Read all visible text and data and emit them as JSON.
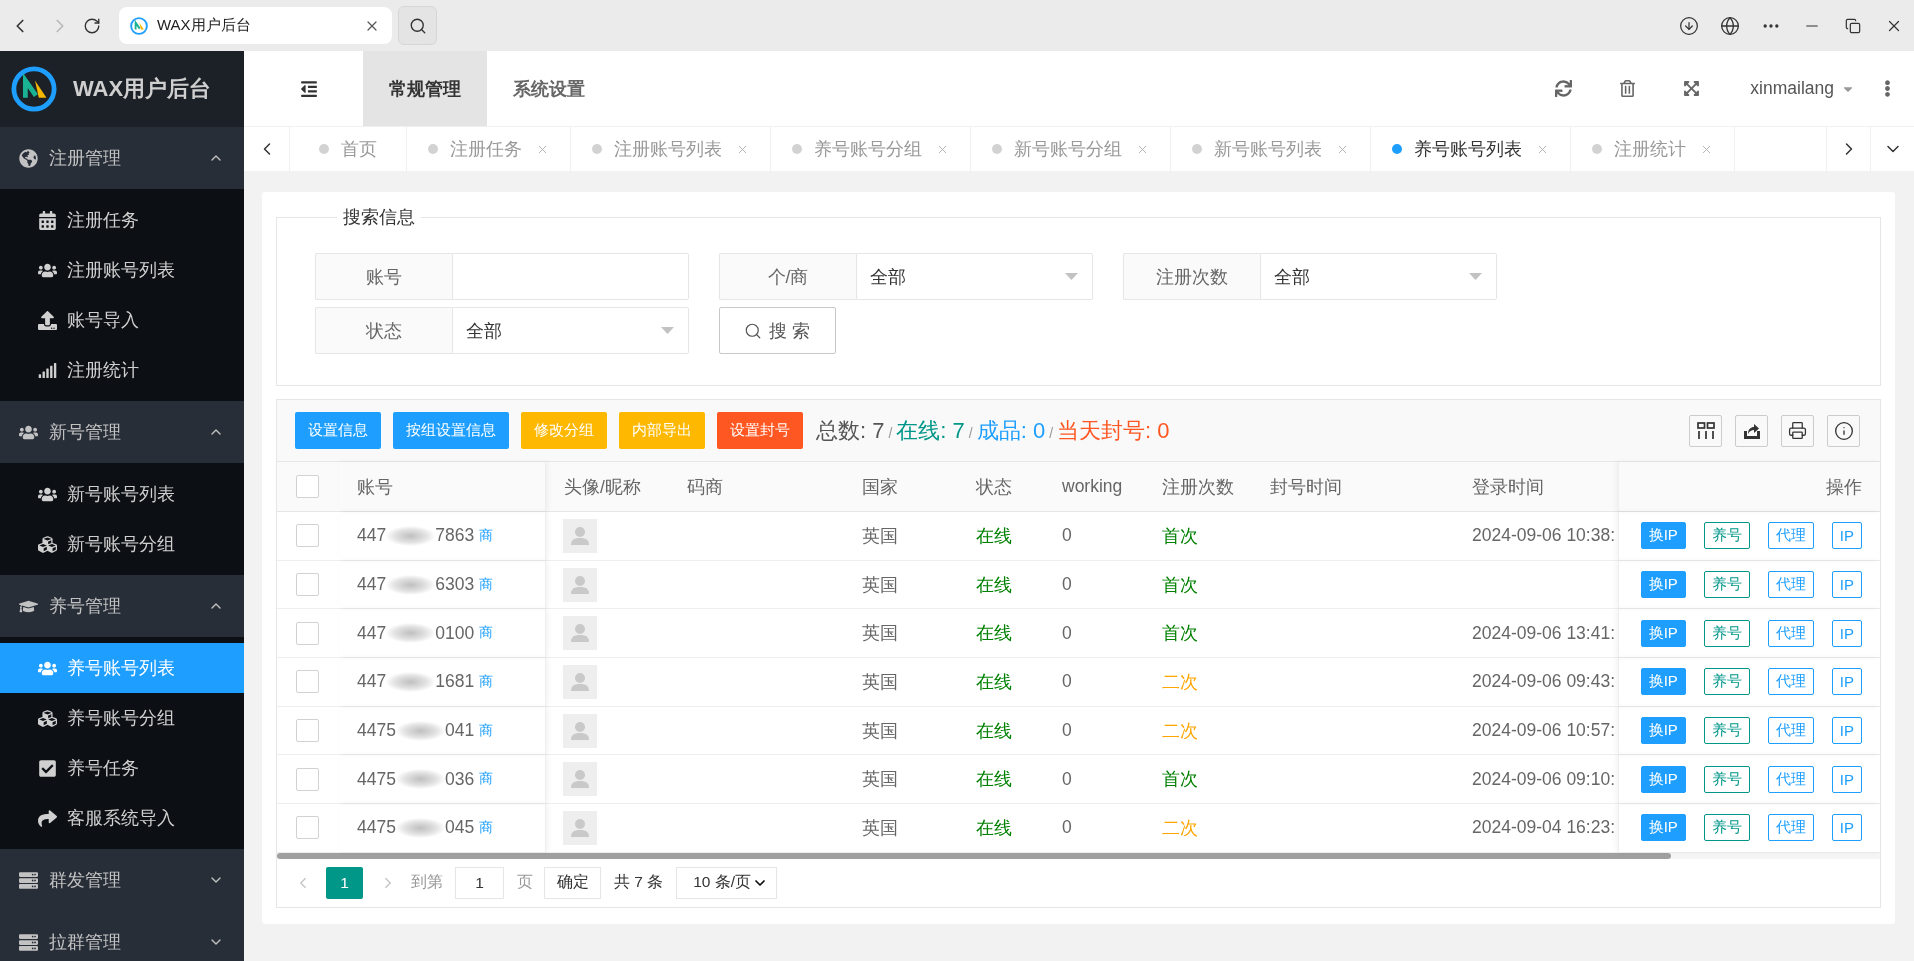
{
  "browser": {
    "tab_title": "WAX用户后台"
  },
  "sidebar": {
    "title": "WAX用户后台",
    "groups": [
      {
        "label": "注册管理",
        "expanded": true,
        "children": [
          {
            "label": "注册任务",
            "selected": false
          },
          {
            "label": "注册账号列表",
            "selected": false
          },
          {
            "label": "账号导入",
            "selected": false
          },
          {
            "label": "注册统计",
            "selected": false
          }
        ]
      },
      {
        "label": "新号管理",
        "expanded": true,
        "children": [
          {
            "label": "新号账号列表",
            "selected": false
          },
          {
            "label": "新号账号分组",
            "selected": false
          }
        ]
      },
      {
        "label": "养号管理",
        "expanded": true,
        "children": [
          {
            "label": "养号账号列表",
            "selected": true
          },
          {
            "label": "养号账号分组",
            "selected": false
          },
          {
            "label": "养号任务",
            "selected": false
          },
          {
            "label": "客服系统导入",
            "selected": false
          }
        ]
      },
      {
        "label": "群发管理",
        "expanded": false
      },
      {
        "label": "拉群管理",
        "expanded": false
      }
    ]
  },
  "header": {
    "nav": [
      {
        "label": "常规管理",
        "selected": true
      },
      {
        "label": "系统设置",
        "selected": false
      }
    ],
    "user": "xinmailang"
  },
  "tabs": [
    {
      "label": "首页",
      "selected": false,
      "closable": false
    },
    {
      "label": "注册任务",
      "selected": false,
      "closable": true
    },
    {
      "label": "注册账号列表",
      "selected": false,
      "closable": true
    },
    {
      "label": "养号账号分组",
      "selected": false,
      "closable": true
    },
    {
      "label": "新号账号分组",
      "selected": false,
      "closable": true
    },
    {
      "label": "新号账号列表",
      "selected": false,
      "closable": true
    },
    {
      "label": "养号账号列表",
      "selected": true,
      "closable": true
    },
    {
      "label": "注册统计",
      "selected": false,
      "closable": true
    }
  ],
  "search": {
    "legend": "搜索信息",
    "fields": [
      {
        "kind": "input",
        "label": "账号"
      },
      {
        "kind": "select",
        "label": "个/商",
        "value": "全部"
      },
      {
        "kind": "select",
        "label": "注册次数",
        "value": "全部"
      },
      {
        "kind": "select",
        "label": "状态",
        "value": "全部"
      }
    ],
    "button": "搜 索"
  },
  "toolbar": {
    "buttons": [
      {
        "label": "设置信息",
        "color": "#1e9fff"
      },
      {
        "label": "按组设置信息",
        "color": "#1e9fff"
      },
      {
        "label": "修改分组",
        "color": "#ffb800"
      },
      {
        "label": "内部导出",
        "color": "#ffb800"
      },
      {
        "label": "设置封号",
        "color": "#ff5722"
      }
    ],
    "stats": [
      {
        "kind": "stat",
        "text": "总数: 7",
        "color": "#555555"
      },
      {
        "kind": "separator",
        "text": "/"
      },
      {
        "kind": "stat",
        "text": "在线: 7",
        "color": "#009688"
      },
      {
        "kind": "separator",
        "text": "/"
      },
      {
        "kind": "stat",
        "text": "成品: 0",
        "color": "#1e9fff"
      },
      {
        "kind": "separator",
        "text": "/"
      },
      {
        "kind": "stat",
        "text": "当天封号: 0",
        "color": "#ff5722"
      }
    ]
  },
  "table": {
    "header_checked": false,
    "columns": [
      "账号",
      "头像/昵称",
      "码商",
      "国家",
      "状态",
      "working",
      "注册次数",
      "封号时间",
      "登录时间",
      "操作"
    ],
    "action_styles": [
      {
        "kind": "solid",
        "color": "#1e9fff"
      },
      {
        "kind": "outline",
        "color": "#009688"
      },
      {
        "kind": "outline",
        "color": "#1e9fff"
      },
      {
        "kind": "outline",
        "color": "#1e9fff"
      }
    ],
    "rows": [
      {
        "checked": false,
        "account_start": "447",
        "account_end": "7863",
        "account_tag": "商",
        "country": "英国",
        "status": "在线",
        "working": "0",
        "reg_count": {
          "text": "首次",
          "color": "#008000"
        },
        "login_time": "2024-09-06 10:38:",
        "actions": [
          "换IP",
          "养号",
          "代理",
          "IP"
        ]
      },
      {
        "checked": false,
        "account_start": "447",
        "account_end": "6303",
        "account_tag": "商",
        "country": "英国",
        "status": "在线",
        "working": "0",
        "reg_count": {
          "text": "首次",
          "color": "#008000"
        },
        "actions": [
          "换IP",
          "养号",
          "代理",
          "IP"
        ]
      },
      {
        "checked": false,
        "account_start": "447",
        "account_end": "0100",
        "account_tag": "商",
        "country": "英国",
        "status": "在线",
        "working": "0",
        "reg_count": {
          "text": "首次",
          "color": "#008000"
        },
        "login_time": "2024-09-06 13:41:",
        "actions": [
          "换IP",
          "养号",
          "代理",
          "IP"
        ]
      },
      {
        "checked": false,
        "account_start": "447",
        "account_end": "1681",
        "account_tag": "商",
        "country": "英国",
        "status": "在线",
        "working": "0",
        "reg_count": {
          "text": "二次",
          "color": "#ffa500"
        },
        "login_time": "2024-09-06 09:43:",
        "actions": [
          "换IP",
          "养号",
          "代理",
          "IP"
        ]
      },
      {
        "checked": false,
        "account_start": "4475",
        "account_end": "041",
        "account_tag": "商",
        "country": "英国",
        "status": "在线",
        "working": "0",
        "reg_count": {
          "text": "二次",
          "color": "#ffa500"
        },
        "login_time": "2024-09-06 10:57:",
        "actions": [
          "换IP",
          "养号",
          "代理",
          "IP"
        ]
      },
      {
        "checked": false,
        "account_start": "4475",
        "account_end": "036",
        "account_tag": "商",
        "country": "英国",
        "status": "在线",
        "working": "0",
        "reg_count": {
          "text": "首次",
          "color": "#008000"
        },
        "login_time": "2024-09-06 09:10:",
        "actions": [
          "换IP",
          "养号",
          "代理",
          "IP"
        ]
      },
      {
        "checked": false,
        "account_start": "4475",
        "account_end": "045",
        "account_tag": "商",
        "country": "英国",
        "status": "在线",
        "working": "0",
        "reg_count": {
          "text": "二次",
          "color": "#ffa500"
        },
        "login_time": "2024-09-04 16:23:",
        "actions": [
          "换IP",
          "养号",
          "代理",
          "IP"
        ]
      }
    ]
  },
  "pagination": {
    "prev_disabled": true,
    "next_disabled": true,
    "pages": [
      {
        "label": "1",
        "selected": true
      }
    ],
    "goto_label": "到第",
    "goto_value": "1",
    "page_unit": "页",
    "confirm": "确定",
    "total": "共 7 条",
    "page_size": "10 条/页"
  }
}
